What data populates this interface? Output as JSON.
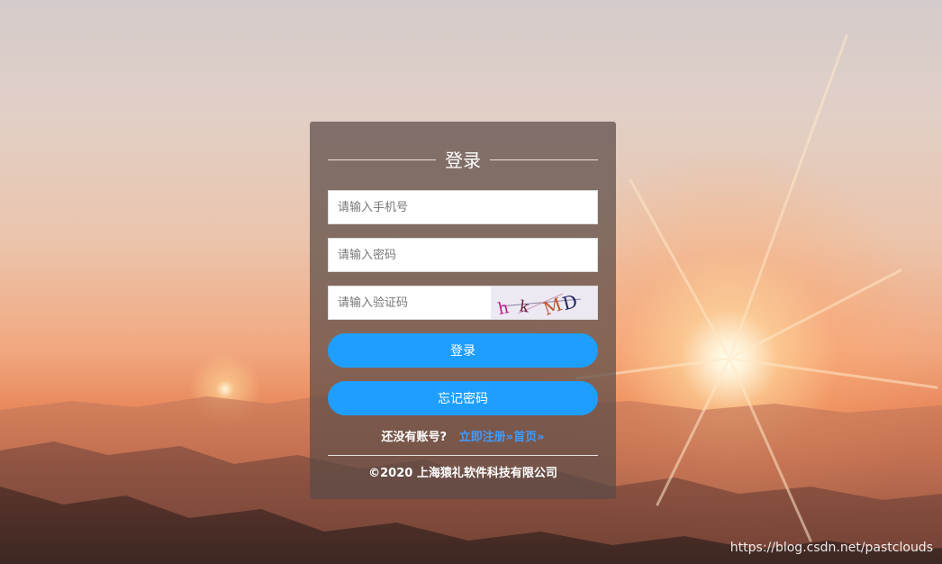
{
  "login_form": {
    "title": "登录",
    "phone_placeholder": "请输入手机号",
    "password_placeholder": "请输入密码",
    "captcha_placeholder": "请输入验证码",
    "captcha_text": "hkMD",
    "login_button": "登录",
    "forgot_button": "忘记密码",
    "no_account_text": "还没有账号?",
    "register_link": "立即注册»",
    "home_link": "首页»",
    "copyright": "©2020 上海猿礼软件科技有限公司"
  },
  "watermark": "https://blog.csdn.net/pastclouds",
  "colors": {
    "primary_button": "#1e9fff",
    "link": "#3f9bff"
  }
}
